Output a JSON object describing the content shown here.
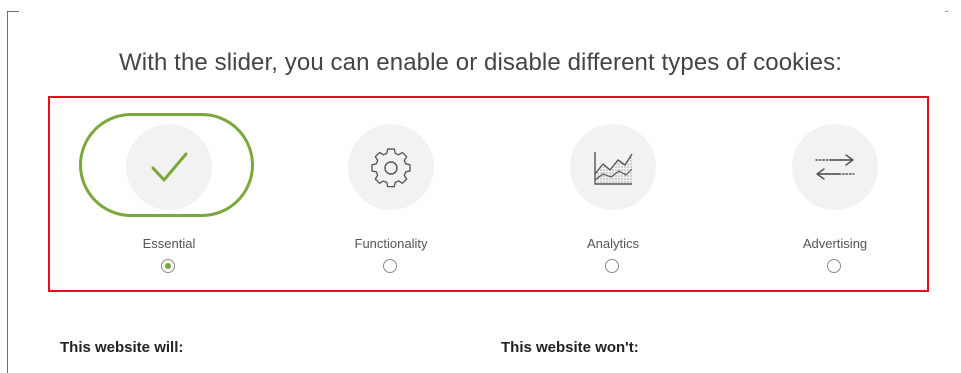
{
  "heading": "With the slider, you can enable or disable different types of cookies:",
  "options": [
    {
      "label": "Essential",
      "icon": "checkmark-icon",
      "selected": true
    },
    {
      "label": "Functionality",
      "icon": "gear-icon",
      "selected": false
    },
    {
      "label": "Analytics",
      "icon": "area-chart-icon",
      "selected": false
    },
    {
      "label": "Advertising",
      "icon": "exchange-arrows-icon",
      "selected": false
    }
  ],
  "will_heading": "This website will:",
  "wont_heading": "This website won't:",
  "colors": {
    "accent": "#7aa83a",
    "highlight_border": "#e01020",
    "icon_background": "#f2f2f2",
    "text": "#444444"
  }
}
